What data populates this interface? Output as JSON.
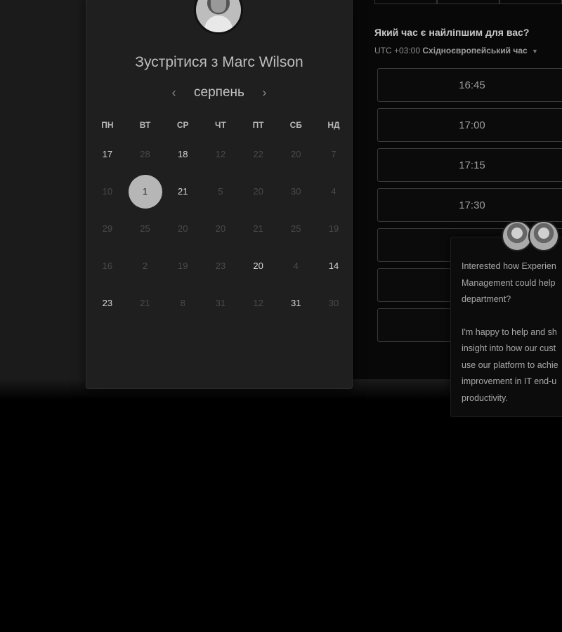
{
  "calendar": {
    "title": "Зустрітися з Marc Wilson",
    "month": "серпень",
    "prev": "‹",
    "next": "›",
    "weekdays": [
      "ПН",
      "ВТ",
      "СР",
      "ЧТ",
      "ПТ",
      "СБ",
      "НД"
    ],
    "weeks": [
      [
        {
          "d": "17",
          "a": true
        },
        {
          "d": "28",
          "a": false
        },
        {
          "d": "18",
          "a": true
        },
        {
          "d": "12",
          "a": false
        },
        {
          "d": "22",
          "a": false
        },
        {
          "d": "20",
          "a": false
        },
        {
          "d": "7",
          "a": false
        }
      ],
      [
        {
          "d": "10",
          "a": false
        },
        {
          "d": "1",
          "a": true,
          "sel": true
        },
        {
          "d": "21",
          "a": true
        },
        {
          "d": "5",
          "a": false
        },
        {
          "d": "20",
          "a": false
        },
        {
          "d": "30",
          "a": false
        },
        {
          "d": "4",
          "a": false
        }
      ],
      [
        {
          "d": "29",
          "a": false
        },
        {
          "d": "25",
          "a": false
        },
        {
          "d": "20",
          "a": false
        },
        {
          "d": "20",
          "a": false
        },
        {
          "d": "21",
          "a": false
        },
        {
          "d": "25",
          "a": false
        },
        {
          "d": "19",
          "a": false
        }
      ],
      [
        {
          "d": "16",
          "a": false
        },
        {
          "d": "2",
          "a": false
        },
        {
          "d": "19",
          "a": false
        },
        {
          "d": "23",
          "a": false
        },
        {
          "d": "20",
          "a": true
        },
        {
          "d": "4",
          "a": false
        },
        {
          "d": "14",
          "a": true
        }
      ],
      [
        {
          "d": "23",
          "a": true
        },
        {
          "d": "21",
          "a": false
        },
        {
          "d": "8",
          "a": false
        },
        {
          "d": "31",
          "a": false
        },
        {
          "d": "12",
          "a": false
        },
        {
          "d": "31",
          "a": true
        },
        {
          "d": "30",
          "a": false
        }
      ]
    ]
  },
  "times": {
    "question": "Який час є найліпшим для вас?",
    "timezone_offset": "UTC +03:00",
    "timezone_name": "Східноєвропейський час",
    "slots": [
      "16:45",
      "17:00",
      "17:15",
      "17:30",
      "",
      "",
      ""
    ]
  },
  "chat": {
    "paragraph1": [
      "Interested how Experien",
      "Management could help",
      "department?"
    ],
    "paragraph2": [
      "I'm happy to help and sh",
      "insight into how our cust",
      "use our platform to achie",
      "improvement in IT end-u",
      "productivity."
    ]
  }
}
